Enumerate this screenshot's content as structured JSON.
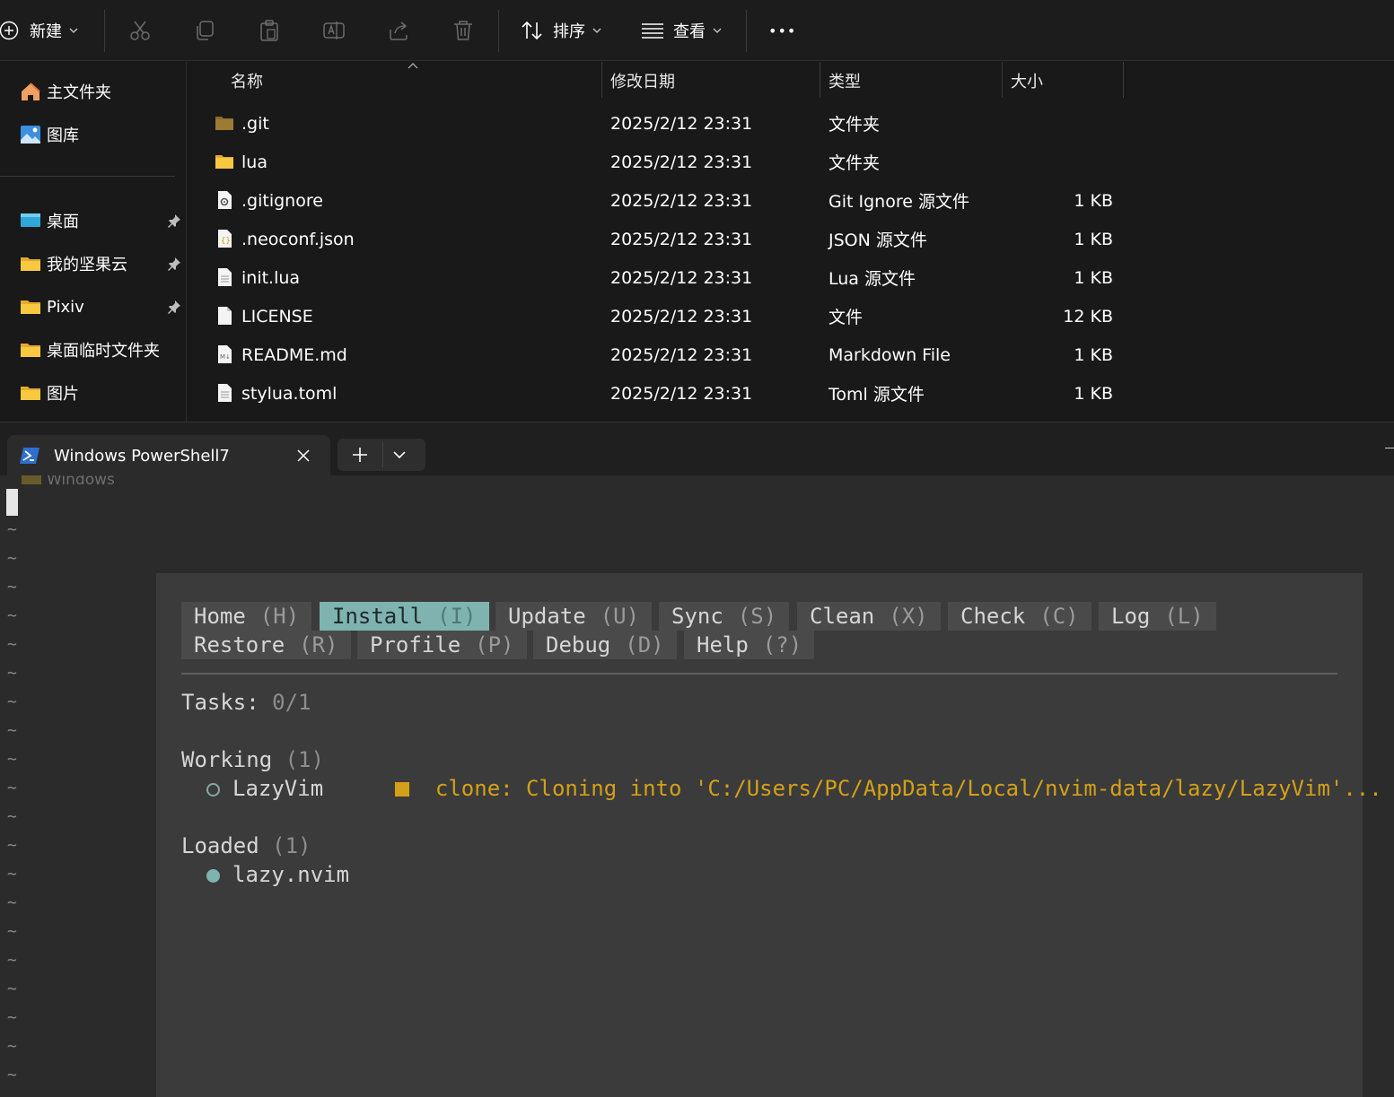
{
  "explorer": {
    "toolbar": {
      "new_label": "新建",
      "sort_label": "排序",
      "view_label": "查看",
      "more_label": "•••"
    },
    "nav": {
      "home": "主文件夹",
      "gallery": "图库",
      "pinned": [
        {
          "label": "桌面",
          "icon": "desktop-icon"
        },
        {
          "label": "我的坚果云",
          "icon": "folder-icon"
        },
        {
          "label": "Pixiv",
          "icon": "folder-icon"
        }
      ],
      "unpinned": [
        {
          "label": "桌面临时文件夹",
          "icon": "folder-icon"
        },
        {
          "label": "图片",
          "icon": "folder-icon"
        }
      ]
    },
    "columns": {
      "name": "名称",
      "date": "修改日期",
      "type": "类型",
      "size": "大小"
    },
    "files": [
      {
        "name": ".git",
        "date": "2025/2/12 23:31",
        "type": "文件夹",
        "size": "",
        "icon": "folder-dim-icon"
      },
      {
        "name": "lua",
        "date": "2025/2/12 23:31",
        "type": "文件夹",
        "size": "",
        "icon": "folder-icon"
      },
      {
        "name": ".gitignore",
        "date": "2025/2/12 23:31",
        "type": "Git Ignore 源文件",
        "size": "1 KB",
        "icon": "settings-file-icon"
      },
      {
        "name": ".neoconf.json",
        "date": "2025/2/12 23:31",
        "type": "JSON 源文件",
        "size": "1 KB",
        "icon": "json-file-icon"
      },
      {
        "name": "init.lua",
        "date": "2025/2/12 23:31",
        "type": "Lua 源文件",
        "size": "1 KB",
        "icon": "text-file-icon"
      },
      {
        "name": "LICENSE",
        "date": "2025/2/12 23:31",
        "type": "文件",
        "size": "12 KB",
        "icon": "blank-file-icon"
      },
      {
        "name": "README.md",
        "date": "2025/2/12 23:31",
        "type": "Markdown File",
        "size": "1 KB",
        "icon": "markdown-file-icon"
      },
      {
        "name": "stylua.toml",
        "date": "2025/2/12 23:31",
        "type": "Toml 源文件",
        "size": "1 KB",
        "icon": "text-file-icon"
      }
    ]
  },
  "terminal": {
    "tab_title": "Windows PowerShell7",
    "ghost_text": "Windows",
    "lazy": {
      "tabs_row1": [
        {
          "label": "Home",
          "key": "(H)"
        },
        {
          "label": "Install",
          "key": "(I)",
          "active": true
        },
        {
          "label": "Update",
          "key": "(U)"
        },
        {
          "label": "Sync",
          "key": "(S)"
        },
        {
          "label": "Clean",
          "key": "(X)"
        },
        {
          "label": "Check",
          "key": "(C)"
        },
        {
          "label": "Log",
          "key": "(L)"
        }
      ],
      "tabs_row2": [
        {
          "label": "Restore",
          "key": "(R)"
        },
        {
          "label": "Profile",
          "key": "(P)"
        },
        {
          "label": "Debug",
          "key": "(D)"
        },
        {
          "label": "Help",
          "key": "(?)"
        }
      ],
      "tasks_label": "Tasks:",
      "tasks_value": "0/1",
      "working_label": "Working",
      "working_count": "(1)",
      "working_plugin": "LazyVim",
      "working_status": "clone: Cloning into 'C:/Users/PC/AppData/Local/nvim-data/lazy/LazyVim'...",
      "loaded_label": "Loaded",
      "loaded_count": "(1)",
      "loaded_plugin": "lazy.nvim"
    },
    "colors": {
      "accent": "#7fb3b0",
      "warning": "#d4a017",
      "float_bg": "#3b3b3b"
    }
  }
}
